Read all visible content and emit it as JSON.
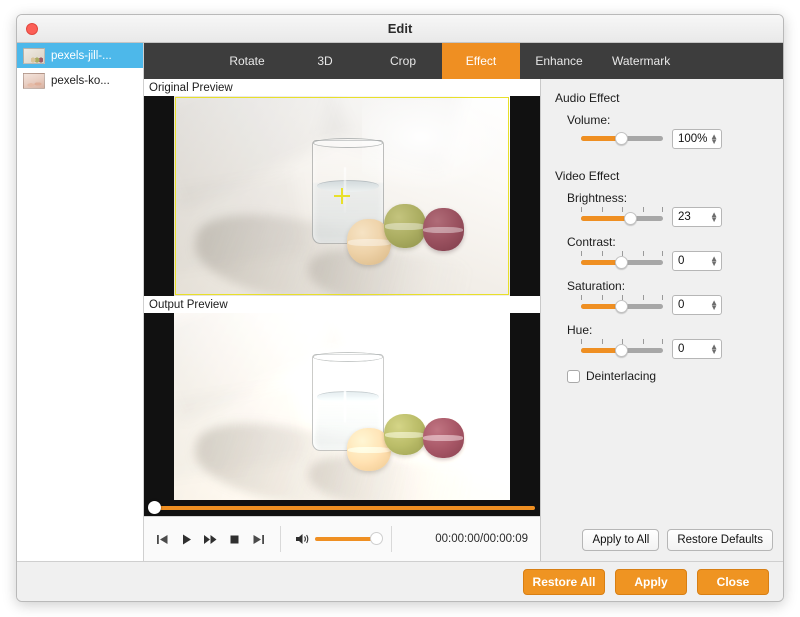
{
  "window": {
    "title": "Edit",
    "close_icon": "close-icon"
  },
  "sidebar": {
    "files": [
      {
        "name": "pexels-jill-...",
        "selected": true
      },
      {
        "name": "pexels-ko...",
        "selected": false
      }
    ]
  },
  "tabs": [
    {
      "label": "Rotate",
      "active": false
    },
    {
      "label": "3D",
      "active": false
    },
    {
      "label": "Crop",
      "active": false
    },
    {
      "label": "Effect",
      "active": true
    },
    {
      "label": "Enhance",
      "active": false
    },
    {
      "label": "Watermark",
      "active": false
    }
  ],
  "preview": {
    "original_label": "Original Preview",
    "output_label": "Output Preview"
  },
  "transport": {
    "previous_icon": "skip-previous-icon",
    "play_icon": "play-icon",
    "forward_icon": "fast-forward-icon",
    "stop_icon": "stop-icon",
    "next_icon": "skip-next-icon",
    "speaker_icon": "speaker-icon",
    "timecode": "00:00:00/00:00:09",
    "seek_percent": 0,
    "volume_percent": 100
  },
  "settings": {
    "audio_group": "Audio Effect",
    "volume_label": "Volume:",
    "volume_value": "100%",
    "volume_percent": 55,
    "video_group": "Video Effect",
    "sliders": [
      {
        "label": "Brightness:",
        "value": "23",
        "percent": 61
      },
      {
        "label": "Contrast:",
        "value": "0",
        "percent": 50
      },
      {
        "label": "Saturation:",
        "value": "0",
        "percent": 50
      },
      {
        "label": "Hue:",
        "value": "0",
        "percent": 50
      }
    ],
    "deinterlacing_label": "Deinterlacing",
    "deinterlacing_checked": false,
    "apply_to_all": "Apply to All",
    "restore_defaults": "Restore Defaults"
  },
  "footer": {
    "restore_all": "Restore All",
    "apply": "Apply",
    "close": "Close"
  },
  "colors": {
    "accent_orange": "#ef9422",
    "tab_bar": "#3d3d3d",
    "selection_blue": "#4db8ea",
    "crop_yellow": "#e8e02a"
  }
}
